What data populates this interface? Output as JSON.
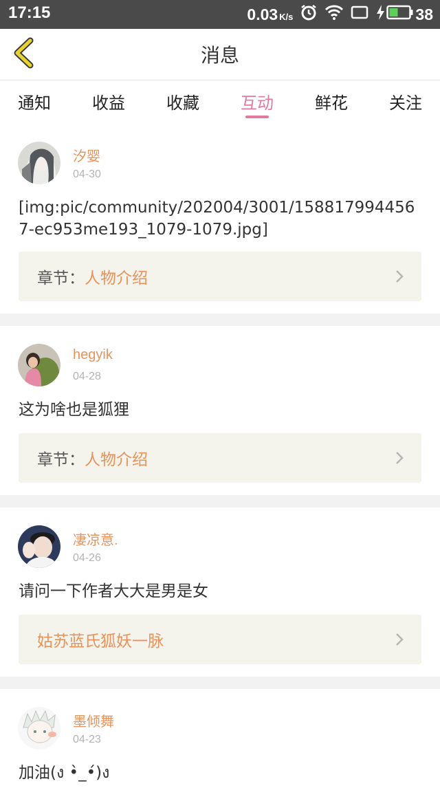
{
  "status_bar": {
    "time": "17:15",
    "network_speed": "0.03",
    "network_unit": "K/s",
    "battery_level": "38",
    "icons": [
      "alarm-icon",
      "wifi-icon",
      "screen-icon",
      "charging-icon",
      "battery-icon"
    ]
  },
  "header": {
    "title": "消息",
    "back_icon": "chevron-left-icon",
    "accent_color": "#e8d22c"
  },
  "tabs": [
    {
      "label": "通知",
      "active": false
    },
    {
      "label": "收益",
      "active": false
    },
    {
      "label": "收藏",
      "active": false
    },
    {
      "label": "互动",
      "active": true
    },
    {
      "label": "鲜花",
      "active": false
    },
    {
      "label": "关注",
      "active": false
    }
  ],
  "colors": {
    "tab_active": "#e07aa0",
    "username": "#e8935a",
    "chapter_bg": "#f4f3ec"
  },
  "messages": [
    {
      "username": "汐婴",
      "date": "04-30",
      "content": "[img:pic/community/202004/3001/1588179944567-ec953me193_1079-1079.jpg]",
      "chapter_label": "章节：",
      "chapter_name": "人物介绍"
    },
    {
      "username": "hegyik",
      "date": "04-28",
      "content": "这为啥也是狐狸",
      "chapter_label": "章节：",
      "chapter_name": "人物介绍"
    },
    {
      "username": "凄凉意.",
      "date": "04-26",
      "content": "请问一下作者大大是男是女",
      "chapter_label": "",
      "chapter_name": "姑苏蓝氏狐妖一脉"
    },
    {
      "username": "墨倾舞",
      "date": "04-23",
      "content": "加油(ง •̀_•́)ง"
    }
  ]
}
